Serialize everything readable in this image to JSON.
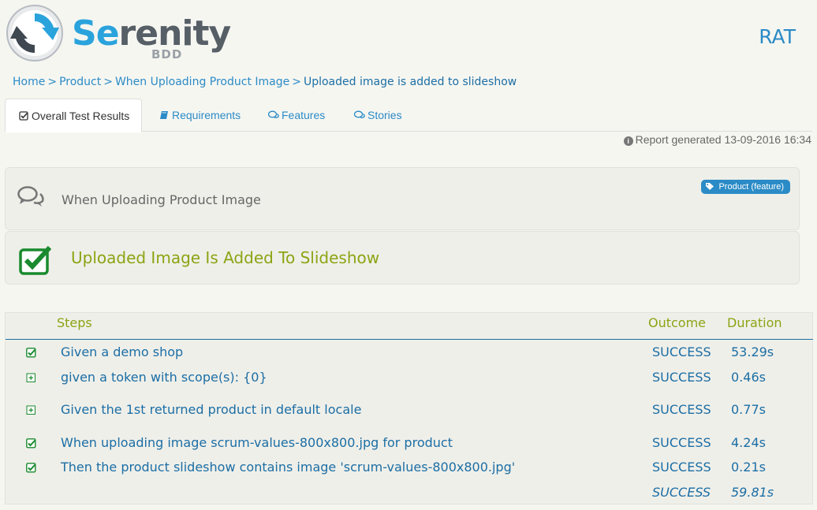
{
  "header": {
    "logo_main_highlight": "Se",
    "logo_main_rest": "renity",
    "logo_sub": "BDD",
    "project": "RAT"
  },
  "breadcrumb": {
    "items": [
      "Home",
      "Product",
      "When Uploading Product Image"
    ],
    "separator": ">",
    "current": "Uploaded image is added to slideshow"
  },
  "tabs": [
    {
      "label": "Overall Test Results",
      "icon": "check-square-icon"
    },
    {
      "label": "Requirements",
      "icon": "book-icon"
    },
    {
      "label": "Features",
      "icon": "comments-icon"
    },
    {
      "label": "Stories",
      "icon": "comments-icon"
    }
  ],
  "report": {
    "text": "Report generated 13-09-2016 16:34",
    "icon": "info-icon"
  },
  "feature": {
    "title": "When Uploading Product Image",
    "tag": "Product (feature)",
    "icon": "comments-icon"
  },
  "scenario": {
    "title": "Uploaded Image Is Added To Slideshow",
    "icon": "check-square-icon"
  },
  "steps": {
    "headers": {
      "steps": "Steps",
      "outcome": "Outcome",
      "duration": "Duration"
    },
    "rows": [
      {
        "description": "Given a demo shop",
        "outcome": "SUCCESS",
        "duration": "53.29s",
        "icon": "check-square-icon"
      },
      {
        "description": "given a token with scope(s): {0}",
        "outcome": "SUCCESS",
        "duration": "0.46s",
        "icon": "plus-square-icon"
      },
      {
        "description": "Given the 1st returned product in default locale",
        "outcome": "SUCCESS",
        "duration": "0.77s",
        "icon": "plus-square-icon"
      },
      {
        "description": "When uploading image scrum-values-800x800.jpg for product",
        "outcome": "SUCCESS",
        "duration": "4.24s",
        "icon": "check-square-icon"
      },
      {
        "description": "Then the product slideshow contains image 'scrum-values-800x800.jpg'",
        "outcome": "SUCCESS",
        "duration": "0.21s",
        "icon": "check-square-icon"
      }
    ],
    "total": {
      "outcome": "SUCCESS",
      "duration": "59.81s"
    }
  },
  "colors": {
    "accent": "#2b8bc6",
    "link": "#1b6ea5",
    "success": "#8ba413",
    "check": "#1a8a2e",
    "background": "#f6f6f1",
    "panel": "#efefe9"
  }
}
